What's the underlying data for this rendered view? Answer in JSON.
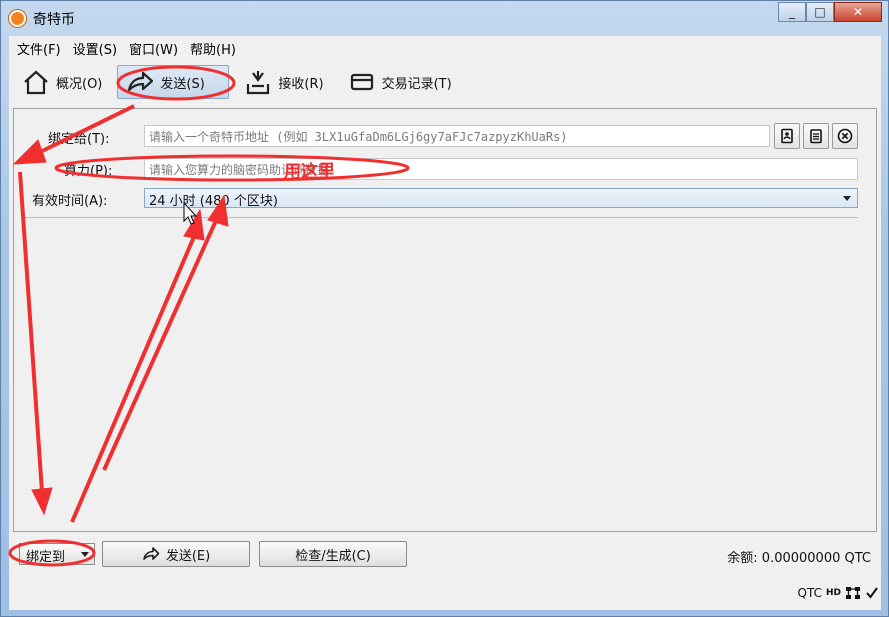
{
  "window": {
    "title": "奇特币",
    "min": "_",
    "max": "□",
    "close": "✕"
  },
  "menu": {
    "items": [
      "文件(F)",
      "设置(S)",
      "窗口(W)",
      "帮助(H)"
    ]
  },
  "toolbar": {
    "overview": "概况(O)",
    "send": "发送(S)",
    "receive": "接收(R)",
    "transactions": "交易记录(T)"
  },
  "form": {
    "bind_to_label": "绑定给(T):",
    "bind_to_placeholder": "请输入一个奇特币地址 (例如 3LX1uGfaDm6LGj6gy7aFJc7azpyzKhUaRs)",
    "power_label": "算力(P):",
    "power_placeholder": "请输入您算力的脑密码助记词数据",
    "validity_label": "有效时间(A):",
    "validity_value": "24 小时 (480 个区块)"
  },
  "annotation": {
    "text": "用这里"
  },
  "bottom": {
    "mode_select": "绑定到",
    "send_button": "发送(E)",
    "check_button": "检查/生成(C)",
    "balance": "余额: 0.00000000 QTC"
  },
  "status": {
    "unit": "QTC",
    "hd": "HD"
  },
  "colors": {
    "annotation_red": "#f03030",
    "window_blue": "#a9c6e6"
  },
  "icons": [
    "home-icon",
    "send-arrow-icon",
    "receive-tray-icon",
    "card-icon",
    "address-book-icon",
    "paste-icon",
    "clear-icon",
    "network-icon",
    "check-icon"
  ]
}
